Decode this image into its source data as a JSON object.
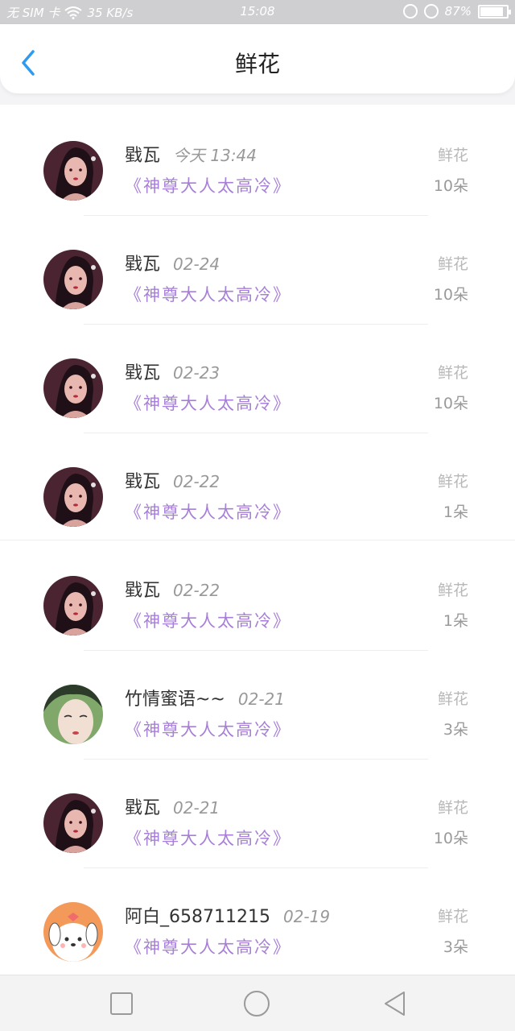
{
  "status_bar": {
    "carrier": "无 SIM 卡",
    "speed": "35 KB/s",
    "time": "15:08",
    "battery": "87%",
    "battery_level": 0.87
  },
  "header": {
    "title": "鲜花"
  },
  "records": [
    {
      "name": "戥瓦",
      "date": "今天 13:44",
      "book": "《神尊大人太高冷》",
      "type": "鲜花",
      "amount": "10朵",
      "avatar": "girl-dark"
    },
    {
      "name": "戥瓦",
      "date": "02-24",
      "book": "《神尊大人太高冷》",
      "type": "鲜花",
      "amount": "10朵",
      "avatar": "girl-dark"
    },
    {
      "name": "戥瓦",
      "date": "02-23",
      "book": "《神尊大人太高冷》",
      "type": "鲜花",
      "amount": "10朵",
      "avatar": "girl-dark"
    },
    {
      "name": "戥瓦",
      "date": "02-22",
      "book": "《神尊大人太高冷》",
      "type": "鲜花",
      "amount": "1朵",
      "avatar": "girl-dark"
    },
    {
      "name": "戥瓦",
      "date": "02-22",
      "book": "《神尊大人太高冷》",
      "type": "鲜花",
      "amount": "1朵",
      "avatar": "girl-dark"
    },
    {
      "name": "竹情蜜语~~",
      "date": "02-21",
      "book": "《神尊大人太高冷》",
      "type": "鲜花",
      "amount": "3朵",
      "avatar": "girl-light"
    },
    {
      "name": "戥瓦",
      "date": "02-21",
      "book": "《神尊大人太高冷》",
      "type": "鲜花",
      "amount": "10朵",
      "avatar": "girl-dark"
    },
    {
      "name": "阿白_658711215",
      "date": "02-19",
      "book": "《神尊大人太高冷》",
      "type": "鲜花",
      "amount": "3朵",
      "avatar": "puppy"
    }
  ],
  "colors": {
    "accent": "#2f9bf0",
    "book_title": "#a77fd8"
  }
}
